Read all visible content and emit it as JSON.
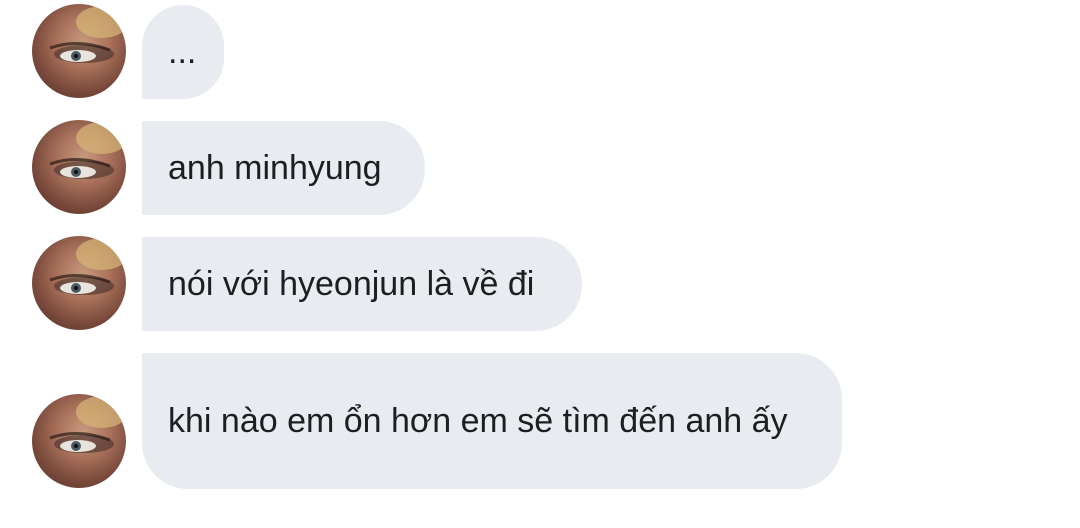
{
  "conversation": {
    "messages": [
      {
        "text": "..."
      },
      {
        "text": "anh minhyung"
      },
      {
        "text": "nói với hyeonjun là về đi"
      },
      {
        "text": "khi nào em ổn hơn em sẽ tìm đến anh ấy"
      }
    ]
  },
  "colors": {
    "bubble_bg": "#e8ecf1",
    "text": "#1c1e21",
    "background": "#ffffff"
  },
  "icons": {
    "avatar": "sender-avatar-photo"
  }
}
